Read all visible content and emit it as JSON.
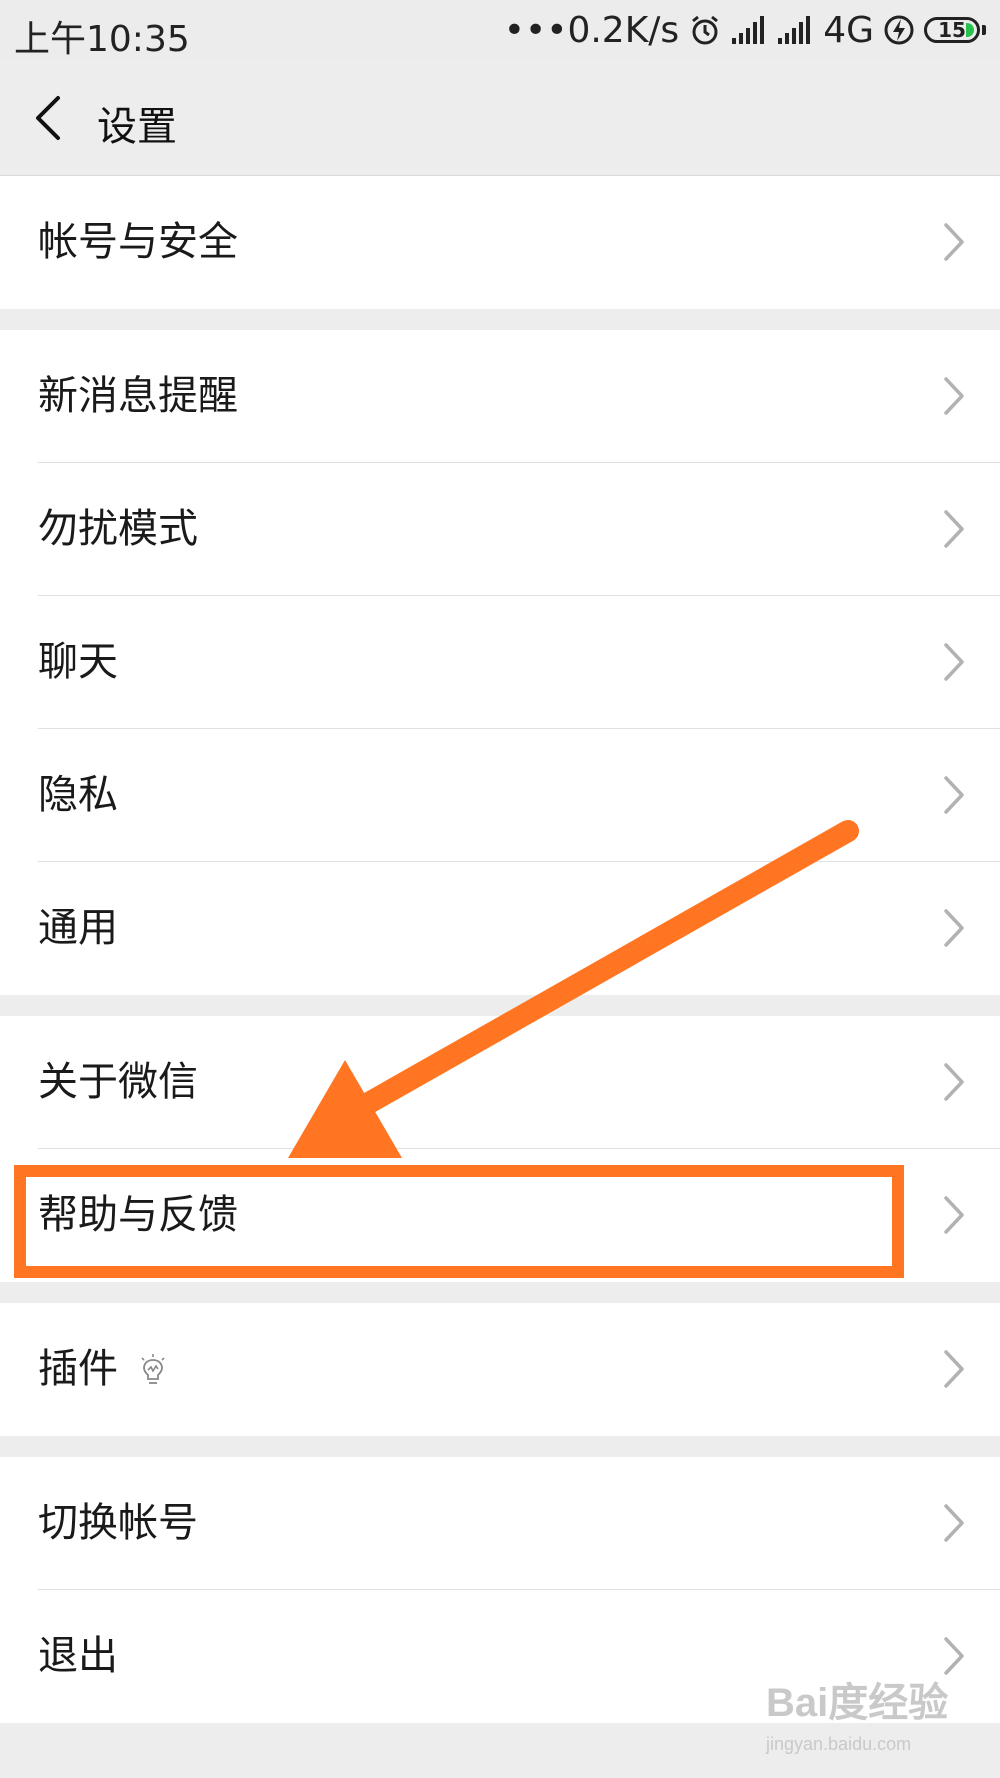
{
  "status_bar": {
    "time": "上午10:35",
    "net_speed": "•••0.2K/s",
    "network_type": "4G",
    "battery_level": "15",
    "icons": [
      "alarm-icon",
      "signal-icon",
      "signal-icon",
      "charging-icon",
      "battery-icon"
    ]
  },
  "header": {
    "title": "设置",
    "back_icon": "chevron-left-icon"
  },
  "groups": [
    {
      "items": [
        {
          "label": "帐号与安全"
        }
      ]
    },
    {
      "items": [
        {
          "label": "新消息提醒"
        },
        {
          "label": "勿扰模式"
        },
        {
          "label": "聊天"
        },
        {
          "label": "隐私"
        },
        {
          "label": "通用"
        }
      ]
    },
    {
      "items": [
        {
          "label": "关于微信"
        },
        {
          "label": "帮助与反馈"
        }
      ]
    },
    {
      "items": [
        {
          "label": "插件",
          "icon": "lightbulb-icon"
        }
      ]
    },
    {
      "items": [
        {
          "label": "切换帐号"
        },
        {
          "label": "退出"
        }
      ]
    }
  ],
  "annotation": {
    "highlighted_item": "帮助与反馈",
    "color": "#ff7522"
  },
  "watermark": {
    "main": "Bai度经验",
    "sub": "jingyan.baidu.com"
  },
  "colors": {
    "background": "#ededed",
    "row": "#ffffff",
    "chevron": "#b2b2b2",
    "charging": "#27c24c"
  }
}
